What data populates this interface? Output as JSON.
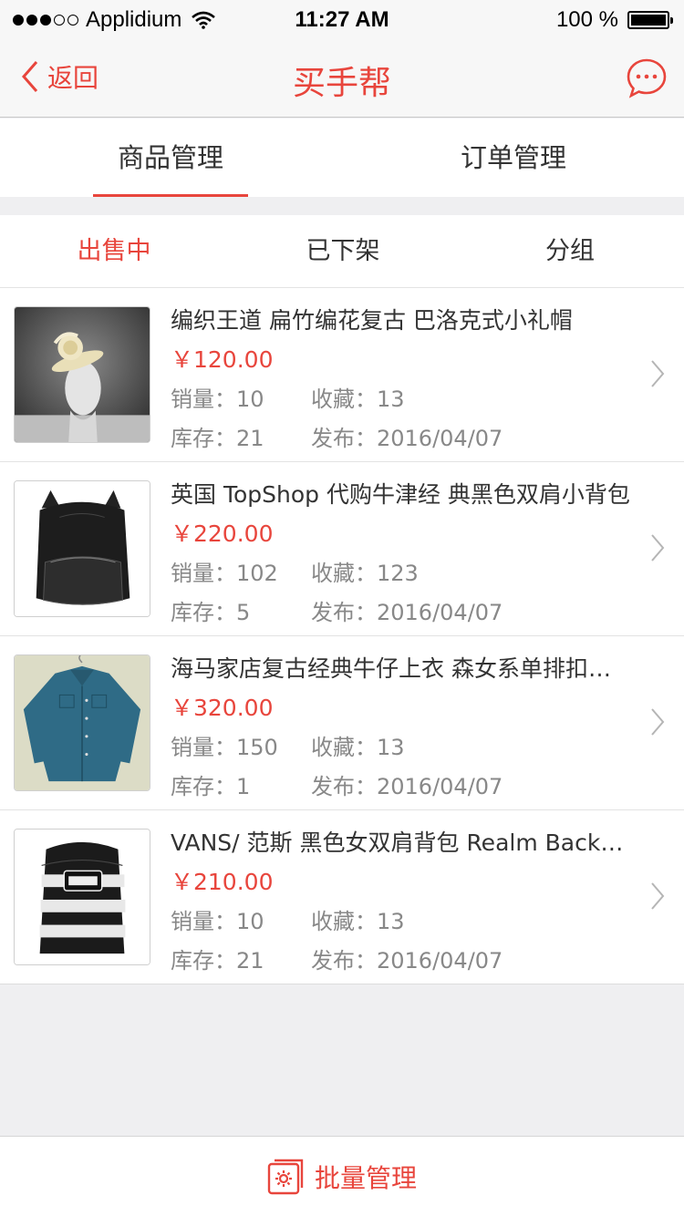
{
  "status_bar": {
    "carrier": "Applidium",
    "time": "11:27 AM",
    "battery": "100 %",
    "signal_dots_filled": 3,
    "signal_dots_total": 5,
    "battery_level": 1.0
  },
  "nav": {
    "back_label": "返回",
    "title": "买手帮",
    "back_icon": "chevron-left-icon",
    "right_icon": "chat-bubble-icon"
  },
  "tabs": [
    {
      "label": "商品管理",
      "active": true
    },
    {
      "label": "订单管理",
      "active": false
    }
  ],
  "subtabs": [
    {
      "label": "出售中",
      "active": true
    },
    {
      "label": "已下架",
      "active": false
    },
    {
      "label": "分组",
      "active": false
    }
  ],
  "labels": {
    "sales": "销量：",
    "favorites": "收藏：",
    "stock": "库存：",
    "published": "发布："
  },
  "products": [
    {
      "name": "编织王道   扁竹编花复古 巴洛克式小礼帽",
      "price": "￥120.00",
      "sales": "10",
      "favorites": "13",
      "stock": "21",
      "published": "2016/04/07",
      "image_icon": "fascinator-hat-image"
    },
    {
      "name": "英国 TopShop 代购牛津经 典黑色双肩小背包",
      "price": "￥220.00",
      "sales": "102",
      "favorites": "123",
      "stock": "5",
      "published": "2016/04/07",
      "image_icon": "black-backpack-image"
    },
    {
      "name": "海马家店复古经典牛仔上衣 森女系单排扣衬衫",
      "price": "￥320.00",
      "sales": "150",
      "favorites": "13",
      "stock": "1",
      "published": "2016/04/07",
      "image_icon": "denim-shirt-image"
    },
    {
      "name": "VANS/ 范斯 黑色女双肩背包 Realm Backpack",
      "price": "￥210.00",
      "sales": "10",
      "favorites": "13",
      "stock": "21",
      "published": "2016/04/07",
      "image_icon": "striped-backpack-image"
    }
  ],
  "bottom": {
    "batch_label": "批量管理",
    "batch_icon": "gear-box-icon"
  },
  "colors": {
    "accent": "#e8453c",
    "background": "#efeff1",
    "text": "#333333",
    "muted": "#888888"
  }
}
